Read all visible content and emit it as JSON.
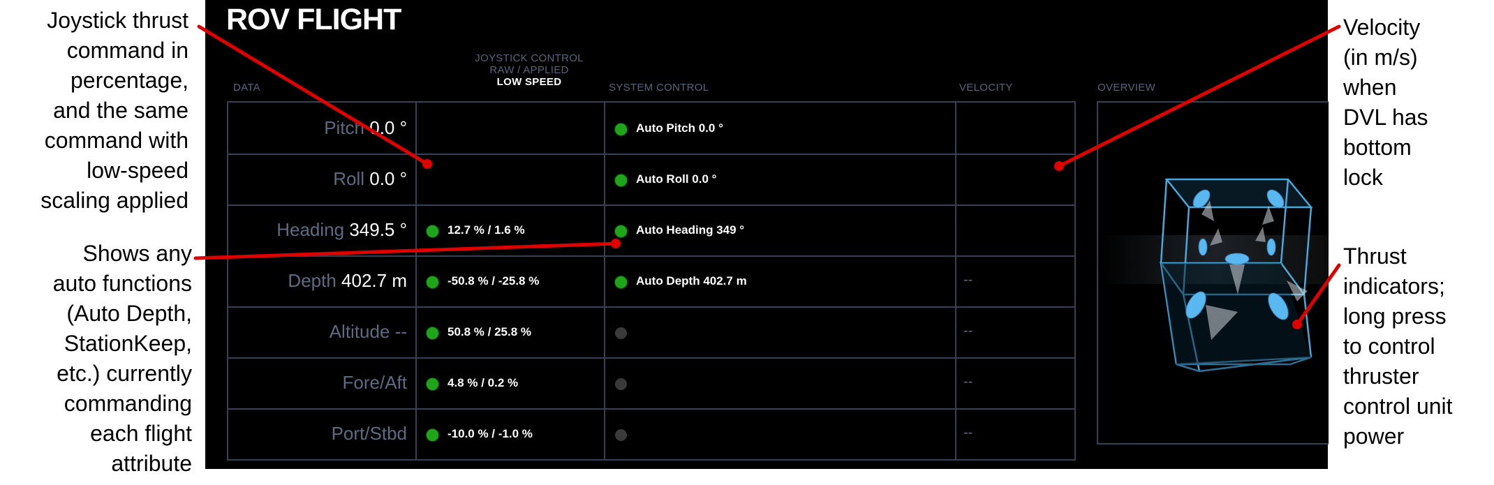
{
  "annotations": {
    "left_top": "Joystick thrust\ncommand in\npercentage,\nand the same\ncommand with\nlow-speed\nscaling applied",
    "left_bottom": "Shows any\nauto functions\n(Auto Depth,\nStationKeep,\netc.) currently\ncommanding\neach flight\nattribute",
    "right_top": "Velocity\n(in m/s)\nwhen\nDVL has\nbottom\nlock",
    "right_bottom": "Thrust\nindicators;\nlong press\nto control\nthruster\ncontrol unit\npower"
  },
  "panel": {
    "title": "ROV FLIGHT",
    "headers": {
      "data": "DATA",
      "joystick_line1": "JOYSTICK CONTROL",
      "joystick_line2": "RAW / APPLIED",
      "joystick_mode": "LOW SPEED",
      "system": "SYSTEM CONTROL",
      "velocity": "VELOCITY",
      "overview": "OVERVIEW"
    },
    "rows": [
      {
        "label": "Pitch",
        "value": "0.0 °",
        "joystick": "",
        "joystick_on": false,
        "joystick_dot": false,
        "system": "Auto Pitch 0.0 °",
        "system_on": true,
        "velocity": ""
      },
      {
        "label": "Roll",
        "value": "0.0 °",
        "joystick": "",
        "joystick_on": false,
        "joystick_dot": false,
        "system": "Auto Roll 0.0 °",
        "system_on": true,
        "velocity": ""
      },
      {
        "label": "Heading",
        "value": "349.5 °",
        "joystick": "12.7 % / 1.6 %",
        "joystick_on": true,
        "joystick_dot": true,
        "system": "Auto Heading 349 °",
        "system_on": true,
        "velocity": ""
      },
      {
        "label": "Depth",
        "value": "402.7 m",
        "joystick": "-50.8 % / -25.8 %",
        "joystick_on": true,
        "joystick_dot": true,
        "system": "Auto Depth 402.7 m",
        "system_on": true,
        "velocity": "--"
      },
      {
        "label": "Altitude",
        "value": "--",
        "joystick": "50.8 % / 25.8 %",
        "joystick_on": true,
        "joystick_dot": true,
        "system": "",
        "system_on": false,
        "velocity": "--"
      },
      {
        "label": "Fore/Aft",
        "value": "",
        "joystick": "4.8 % / 0.2 %",
        "joystick_on": true,
        "joystick_dot": true,
        "system": "",
        "system_on": false,
        "velocity": "--"
      },
      {
        "label": "Port/Stbd",
        "value": "",
        "joystick": "-10.0 % / -1.0 %",
        "joystick_on": true,
        "joystick_dot": true,
        "system": "",
        "system_on": false,
        "velocity": "--"
      }
    ]
  },
  "colors": {
    "panel_bg": "#000000",
    "grid_line": "#334355",
    "label_gray": "#5d6b82",
    "status_on": "#1fa51a",
    "status_off": "#3a3a3a",
    "annotation_line": "#e00000",
    "thruster_blue": "#5ab8f0"
  }
}
